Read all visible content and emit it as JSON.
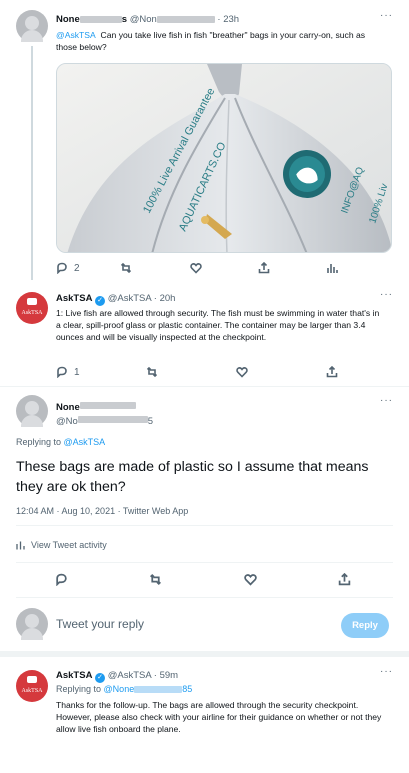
{
  "tweet1": {
    "name": "None",
    "handle": "@Non",
    "time": "23h",
    "mention": "@AskTSA",
    "text": "Can you take live fish in fish \"breather\" bags in your carry-on, such as those below?",
    "reply_count": "2",
    "bag_text_1": "100% Live Arrival Guarantee",
    "bag_text_2": "AQUATICARTS.CO",
    "bag_text_3": "INFO@AQ",
    "bag_text_4": "100% Liv"
  },
  "tweet2": {
    "name": "AskTSA",
    "handle": "@AskTSA",
    "time": "20h",
    "text": "1: Live fish are allowed through security. The fish must be swimming in water that's in a clear, spill-proof glass or plastic container. The container may be larger than 3.4 ounces and will be visually inspected at the checkpoint.",
    "reply_count": "1",
    "avatar_text": "AskTSA"
  },
  "main_tweet": {
    "name": "None",
    "handle": "@No",
    "handle_tail": "5",
    "replying_to_label": "Replying to",
    "replying_to": "@AskTSA",
    "text": "These bags are made of plastic so I assume that means they are ok then?",
    "meta": "12:04 AM · Aug 10, 2021 · Twitter Web App",
    "activity_label": "View Tweet activity"
  },
  "reply_box": {
    "placeholder": "Tweet your reply",
    "button": "Reply"
  },
  "tweet3": {
    "name": "AskTSA",
    "handle": "@AskTSA",
    "time": "59m",
    "replying_to_label": "Replying to",
    "replying_to": "@None",
    "replying_to_tail": "85",
    "text": "Thanks for the follow-up. The bags are allowed through the security checkpoint. However, please also check with your airline for their guidance on whether or not they allow live fish onboard the plane.",
    "avatar_text": "AskTSA"
  },
  "colors": {
    "accent": "#1d9bf0",
    "tsa_red": "#d5393d",
    "muted": "#536471"
  },
  "icons": [
    "more-icon",
    "reply-icon",
    "retweet-icon",
    "like-icon",
    "share-icon",
    "analytics-icon",
    "verified-icon",
    "bar-chart-icon"
  ]
}
